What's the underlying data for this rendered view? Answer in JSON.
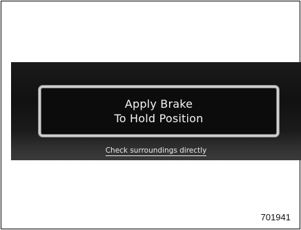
{
  "display": {
    "message_line_1": "Apply Brake",
    "message_line_2": "To Hold Position",
    "footnote": "Check surroundings directly"
  },
  "figure_id": "701941",
  "colors": {
    "screen_background": "#111111",
    "message_border": "#cfcfcf",
    "text": "#f4f4f4"
  }
}
